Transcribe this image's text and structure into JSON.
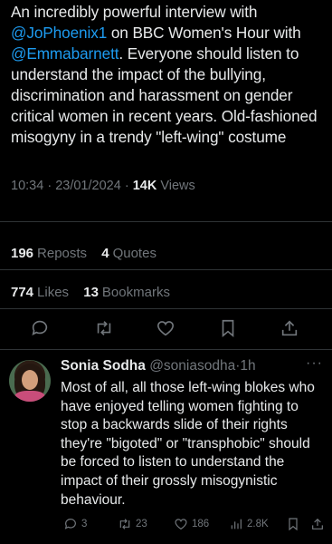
{
  "tweet": {
    "text_before_mention1": "An incredibly powerful interview with ",
    "mention1": "@JoPhoenix1",
    "text_between_mentions": " on BBC Women's Hour with ",
    "mention2": "@Emmabarnett",
    "text_after_mention2": ". Everyone should listen to understand the impact of the bullying, discrimination and harassment on gender critical women in recent years. Old-fashioned misogyny in a trendy \"left-wing\" costume",
    "time": "10:34",
    "date": "23/01/2024",
    "views_count": "14K",
    "views_label": "Views",
    "separator": "·"
  },
  "stats": {
    "reposts_count": "196",
    "reposts_label": "Reposts",
    "quotes_count": "4",
    "quotes_label": "Quotes",
    "likes_count": "774",
    "likes_label": "Likes",
    "bookmarks_count": "13",
    "bookmarks_label": "Bookmarks"
  },
  "actions": [
    "reply-icon",
    "repost-icon",
    "like-icon",
    "bookmark-icon",
    "share-icon"
  ],
  "reply": {
    "name": "Sonia Sodha",
    "handle": "@soniasodha",
    "separator": "·",
    "time": "1h",
    "more": "···",
    "text": "Most of all, all those left-wing blokes who have enjoyed telling women fighting to stop a backwards slide of their rights they're \"bigoted\" or \"transphobic\" should be forced to listen to understand the impact of their grossly misogynistic behaviour.",
    "replies": "3",
    "reposts": "23",
    "likes": "186",
    "views": "2.8K"
  },
  "colors": {
    "background": "#000000",
    "text": "#e7e9ea",
    "muted": "#71767b",
    "link": "#1d9bf0",
    "divider": "#2f3336"
  }
}
